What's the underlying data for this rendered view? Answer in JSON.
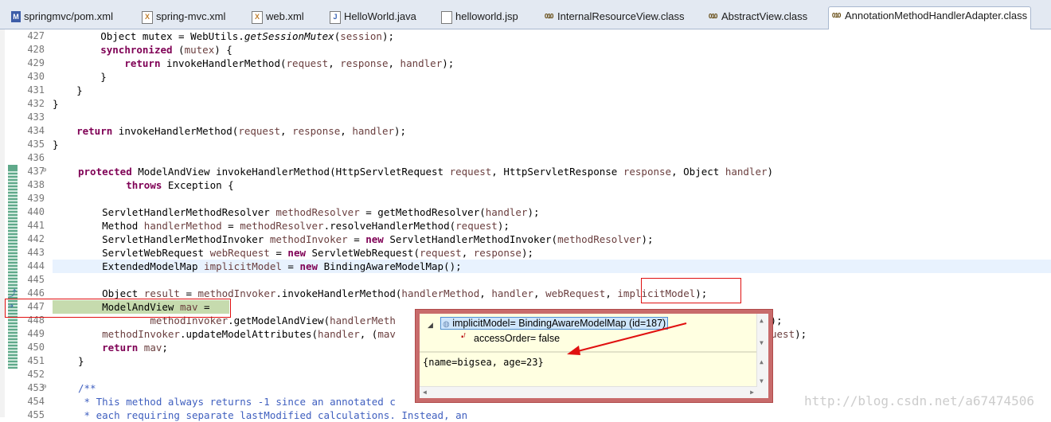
{
  "tabs": [
    {
      "label": "springmvc/pom.xml",
      "icon": "maven-icon"
    },
    {
      "label": "spring-mvc.xml",
      "icon": "xml-file-icon"
    },
    {
      "label": "web.xml",
      "icon": "xml-file-icon"
    },
    {
      "label": "HelloWorld.java",
      "icon": "java-file-icon"
    },
    {
      "label": "helloworld.jsp",
      "icon": "jsp-file-icon"
    },
    {
      "label": "InternalResourceView.class",
      "icon": "class-file-icon"
    },
    {
      "label": "AbstractView.class",
      "icon": "class-file-icon"
    },
    {
      "label": "AnnotationMethodHandlerAdapter.class",
      "icon": "class-file-icon"
    }
  ],
  "lines": [
    {
      "n": "427"
    },
    {
      "n": "428"
    },
    {
      "n": "429"
    },
    {
      "n": "430"
    },
    {
      "n": "431"
    },
    {
      "n": "432"
    },
    {
      "n": "433"
    },
    {
      "n": "434"
    },
    {
      "n": "435"
    },
    {
      "n": "436"
    },
    {
      "n": "437"
    },
    {
      "n": "438"
    },
    {
      "n": "439"
    },
    {
      "n": "440"
    },
    {
      "n": "441"
    },
    {
      "n": "442"
    },
    {
      "n": "443"
    },
    {
      "n": "444"
    },
    {
      "n": "445"
    },
    {
      "n": "446"
    },
    {
      "n": "447"
    },
    {
      "n": "448"
    },
    {
      "n": "449"
    },
    {
      "n": "450"
    },
    {
      "n": "451"
    },
    {
      "n": "452"
    },
    {
      "n": "453"
    },
    {
      "n": "454"
    },
    {
      "n": "455"
    }
  ],
  "popup": {
    "root_label": "implicitModel= BindingAwareModelMap  (id=187)",
    "child_label": "accessOrder= false",
    "detail": "{name=bigsea, age=23}"
  },
  "watermark": "http://blog.csdn.net/a67474506",
  "colors": {
    "keyword": "#7f0055",
    "comment": "#3f5fbf",
    "highlight": "#c6dbae",
    "annotation": "#e01010"
  }
}
